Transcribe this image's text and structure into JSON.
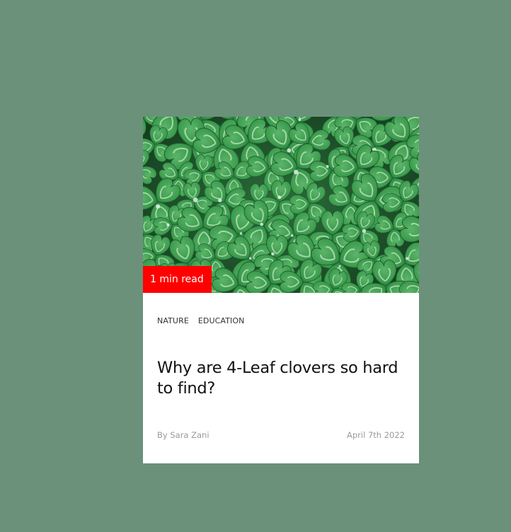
{
  "card": {
    "image_description": "clover-leaves-with-water-droplets",
    "read_time": "1 min read",
    "tags": [
      "NATURE",
      "EDUCATION"
    ],
    "title": "Why are 4-Leaf clovers so hard to find?",
    "author": "By Sara Zani",
    "date": "April 7th 2022"
  },
  "colors": {
    "background": "#6b917b",
    "card": "#ffffff",
    "badge": "#ff0000",
    "muted_text": "#9a9a9a"
  }
}
